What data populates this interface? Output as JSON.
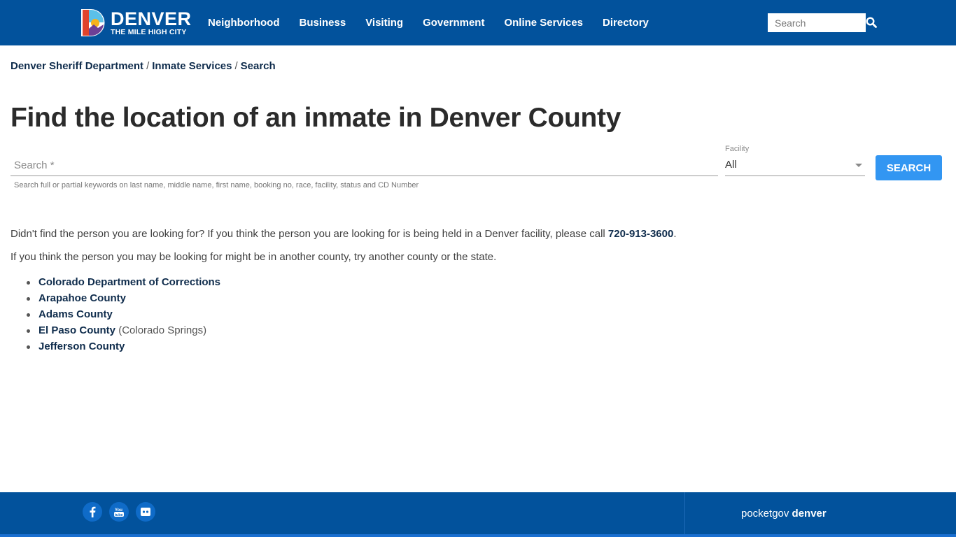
{
  "header": {
    "logo_title": "DENVER",
    "logo_subtitle": "THE MILE HIGH CITY",
    "nav": [
      "Neighborhood",
      "Business",
      "Visiting",
      "Government",
      "Online Services",
      "Directory"
    ],
    "search_placeholder": "Search",
    "search_icon": "search-icon"
  },
  "breadcrumb": [
    "Denver Sheriff Department",
    "Inmate Services",
    "Search"
  ],
  "page_title": "Find the location of an inmate in Denver County",
  "form": {
    "search_placeholder": "Search *",
    "search_value": "",
    "search_help": "Search full or partial keywords on last name, middle name, first name, booking no, race, facility, status and CD Number",
    "facility_label": "Facility",
    "facility_value": "All",
    "search_button": "SEARCH",
    "button_color": "#3296f2"
  },
  "content": {
    "para1_text": "Didn't find the person you are looking for? If you think the person you are looking for is being held in a Denver facility, please call ",
    "phone": "720-913-3600",
    "para1_end": ".",
    "para2": "If you think the person you may be looking for might be in another county, try another county or the state.",
    "links": [
      {
        "label": "Colorado Department of Corrections",
        "note": ""
      },
      {
        "label": "Arapahoe County",
        "note": ""
      },
      {
        "label": "Adams County",
        "note": ""
      },
      {
        "label": "El Paso County",
        "note": " (Colorado Springs)"
      },
      {
        "label": "Jefferson County",
        "note": ""
      }
    ]
  },
  "footer": {
    "social": [
      "facebook-icon",
      "youtube-icon",
      "flickr-icon"
    ],
    "pocketgov_prefix": "pocketgov ",
    "pocketgov_bold": "denver"
  },
  "colors": {
    "header_bg": "#02529c",
    "link": "#0f2c4c"
  }
}
